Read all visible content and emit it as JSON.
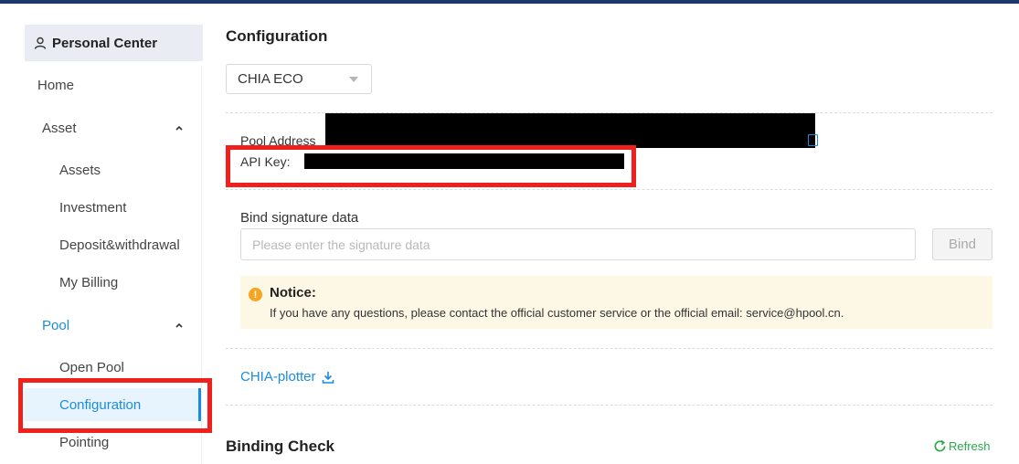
{
  "sidebar": {
    "header": "Personal Center",
    "items": [
      {
        "label": "Home"
      },
      {
        "label": "Asset"
      },
      {
        "label": "Assets"
      },
      {
        "label": "Investment"
      },
      {
        "label": "Deposit&withdrawal"
      },
      {
        "label": "My Billing"
      },
      {
        "label": "Pool"
      },
      {
        "label": "Open Pool"
      },
      {
        "label": "Configuration"
      },
      {
        "label": "Pointing"
      }
    ],
    "active_item": "Configuration"
  },
  "main": {
    "title": "Configuration",
    "coin_select": {
      "value": "CHIA ECO"
    },
    "pool_address_label": "Pool Address",
    "api_key_label": "API Key:",
    "bind": {
      "label": "Bind signature data",
      "placeholder": "Please enter the signature data",
      "button": "Bind"
    },
    "notice": {
      "title": "Notice:",
      "text": "If you have any questions, please contact the official customer service or the official email: service@hpool.cn."
    },
    "plotter_link": "CHIA-plotter",
    "binding_check_title": "Binding Check",
    "refresh_label": "Refresh"
  },
  "colors": {
    "accent": "#1a8ce0",
    "highlight_box": "#f0211c",
    "topbar": "#1b3a6b",
    "refresh": "#2aa84a",
    "notice_bg": "#fdf7e5"
  },
  "icons": [
    "user-icon",
    "chevron-up-icon",
    "dropdown-caret-icon",
    "copy-icon",
    "warning-icon",
    "download-icon",
    "refresh-icon"
  ]
}
